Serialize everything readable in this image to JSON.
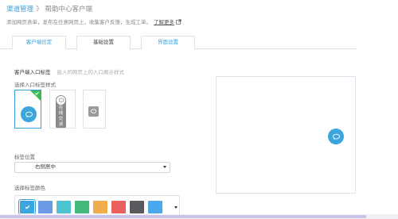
{
  "breadcrumb": {
    "root": "渠道管理",
    "separator": "》",
    "current": "帮助中心客户端"
  },
  "description": {
    "text": "添加网页表单，发布在任意网页上，收集客户反馈，生成工单。",
    "learn_more": "了解更多"
  },
  "tabs": [
    {
      "label": "客户端信定",
      "active": false
    },
    {
      "label": "基础设置",
      "active": true
    },
    {
      "label": "界面设置",
      "active": false
    }
  ],
  "section": {
    "title": "客户端入口标签",
    "hint": "嵌入的网页上的入口展示样式"
  },
  "style_label": "选择入口标签样式",
  "styles": [
    {
      "name": "bubble",
      "selected": true
    },
    {
      "name": "vertical-pill",
      "text": "在线交谈",
      "selected": false
    },
    {
      "name": "square",
      "selected": false
    }
  ],
  "position": {
    "label": "标签位置",
    "value": "右侧居中"
  },
  "color": {
    "label": "选择标签颜色",
    "swatches": [
      "#3aa6dd",
      "#6c9be6",
      "#4cc3cf",
      "#45b97c",
      "#f0ad4e",
      "#e9605f",
      "#5a5a5e",
      "#4aa8ec"
    ],
    "selected_index": 0
  },
  "colors": {
    "accent": "#3aa0dc",
    "check_green": "#3cba54"
  }
}
